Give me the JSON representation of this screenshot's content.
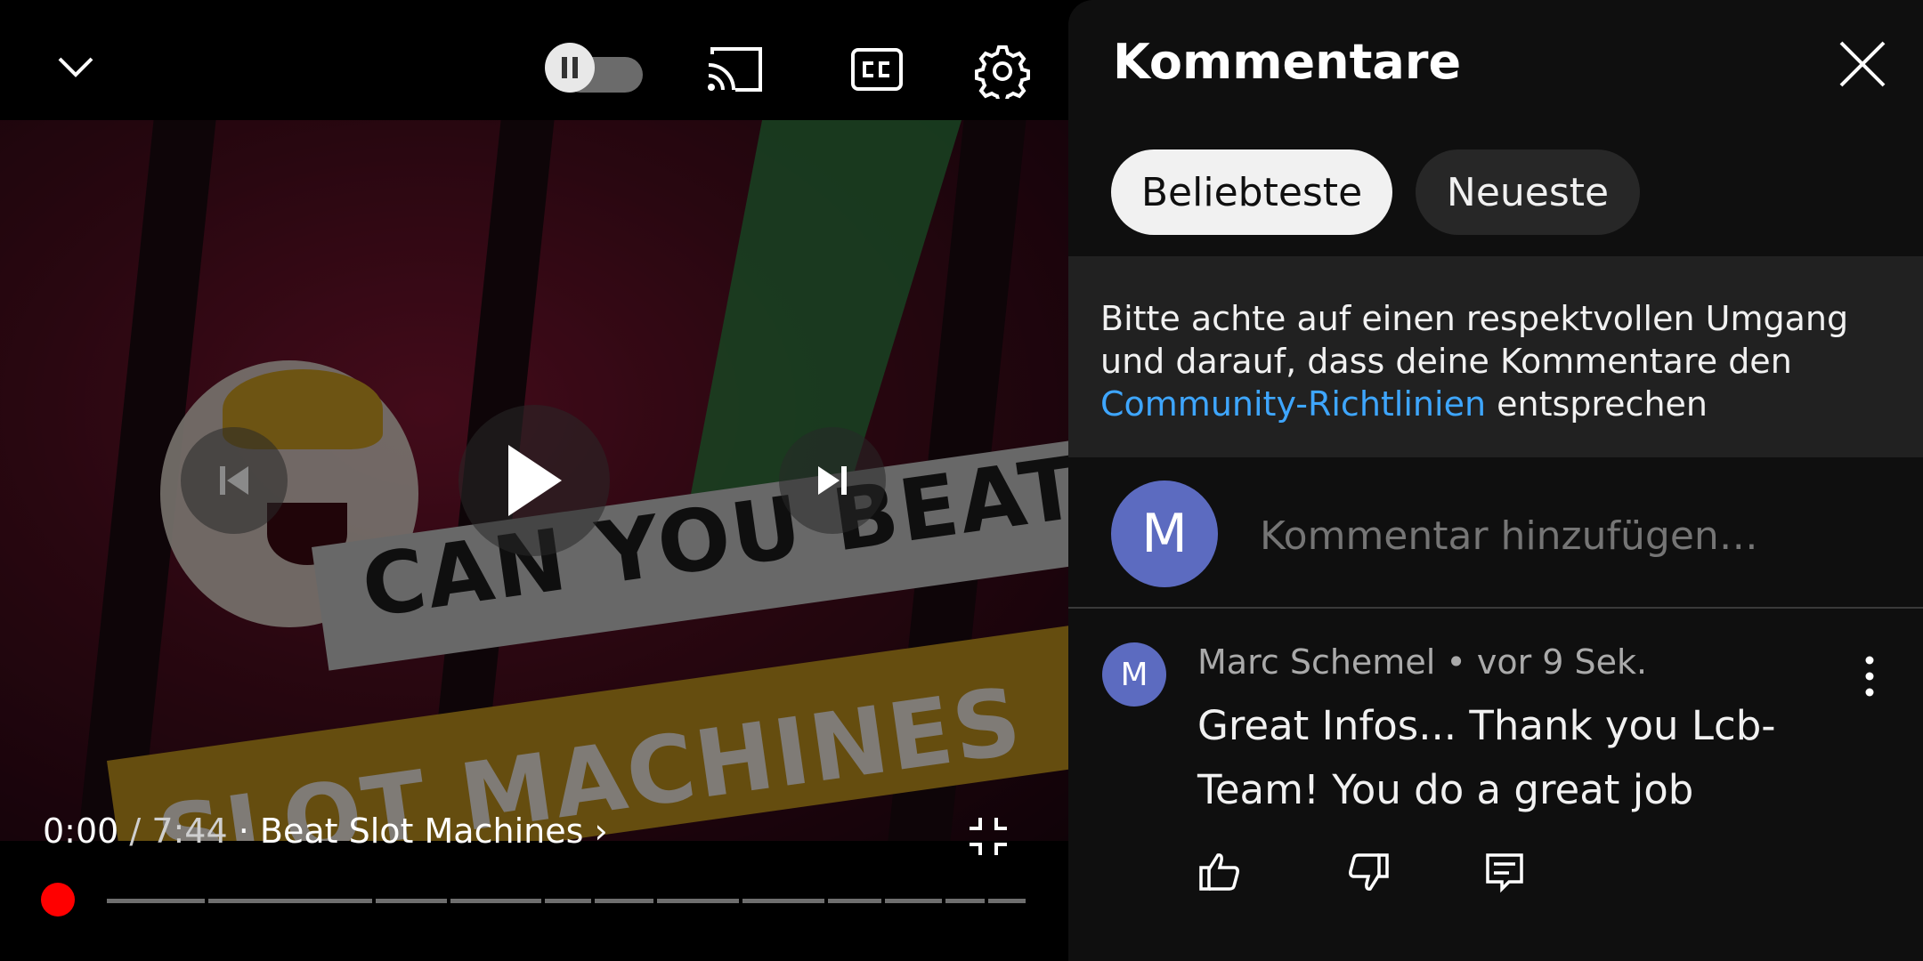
{
  "video": {
    "current_time": "0:00",
    "separator": " / ",
    "duration": "7:44",
    "chapter_separator": " · ",
    "chapter_title": "Beat Slot Machines",
    "chapter_chevron": "›",
    "thumbnail_text_top": "CAN YOU BEAT",
    "thumbnail_text_bottom": "SLOT MACHINES",
    "progress_percent": 0,
    "autoplay_state": "paused"
  },
  "icons": {
    "collapse": "chevron-down-icon",
    "autoplay": "autoplay-toggle-icon",
    "cast": "cast-icon",
    "captions": "closed-captions-icon",
    "settings": "gear-icon",
    "previous": "skip-previous-icon",
    "play": "play-icon",
    "next": "skip-next-icon",
    "fullscreen_exit": "fullscreen-exit-icon",
    "close": "close-icon",
    "more": "more-vert-icon",
    "like": "thumb-up-icon",
    "dislike": "thumb-down-icon",
    "reply": "reply-icon"
  },
  "comments": {
    "title": "Kommentare",
    "chips": [
      "Beliebteste",
      "Neueste"
    ],
    "notice_prefix": "Bitte achte auf einen respektvollen Umgang und darauf, dass deine Kommentare den ",
    "notice_link": "Community-Richtlinien",
    "notice_suffix": " entsprechen",
    "my_avatar_letter": "M",
    "input_placeholder": "Kommentar hinzufügen…",
    "items": [
      {
        "avatar_letter": "M",
        "author": "Marc Schemel",
        "meta_separator": " • ",
        "time": "vor 9 Sek.",
        "text": "Great Infos... Thank you Lcb-Team! You do a great job"
      }
    ]
  },
  "colors": {
    "panel_bg": "#0f0f0f",
    "accent_link": "#3ea6ff",
    "scrubber": "#ff0000",
    "avatar": "#5c6bc0"
  }
}
